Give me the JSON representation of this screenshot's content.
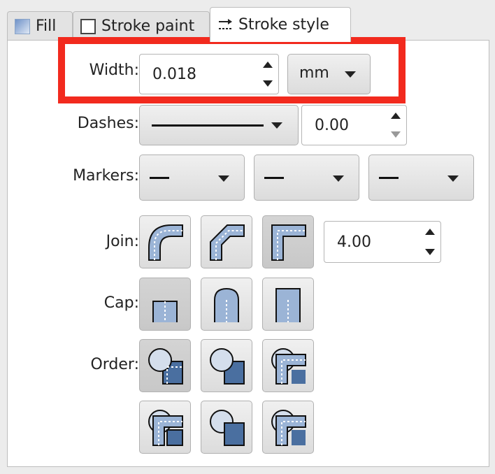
{
  "tabs": [
    {
      "label": "Fill",
      "icon": "fill-swatch-icon"
    },
    {
      "label": "Stroke paint",
      "icon": "stroke-swatch-icon"
    },
    {
      "label": "Stroke style",
      "icon": "stroke-style-icon",
      "active": true
    }
  ],
  "width": {
    "label": "Width:",
    "value": "0.018",
    "unit": "mm"
  },
  "dashes": {
    "label": "Dashes:",
    "offset": "0.00"
  },
  "markers": {
    "label": "Markers:"
  },
  "join": {
    "label": "Join:",
    "miter_limit": "4.00",
    "options": [
      "round-join",
      "bevel-join",
      "miter-join"
    ],
    "selected": "miter-join"
  },
  "cap": {
    "label": "Cap:",
    "options": [
      "butt-cap",
      "round-cap",
      "square-cap"
    ],
    "selected": "butt-cap"
  },
  "order": {
    "label": "Order:",
    "options": [
      "fill-markers-stroke",
      "stroke-fill-markers",
      "fill-stroke-markers",
      "markers-fill-stroke",
      "stroke-markers-fill",
      "markers-stroke-fill"
    ],
    "selected": "fill-markers-stroke"
  },
  "colors": {
    "highlight": "#f22a1e",
    "icon_fill": "#9bb4d6",
    "icon_dark": "#4a6fa0"
  }
}
